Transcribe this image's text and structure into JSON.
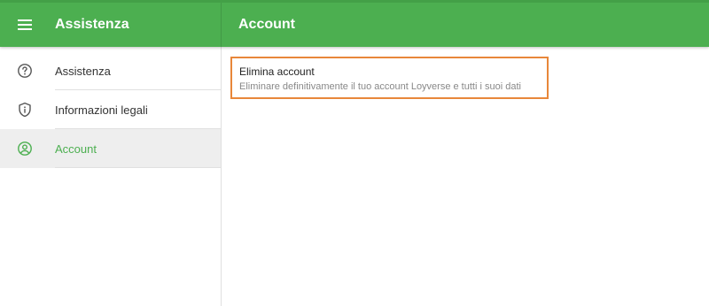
{
  "topbar": {
    "app_title": "Assistenza",
    "section_title": "Account",
    "color": "#4caf50",
    "menu_icon": "hamburger-menu-icon"
  },
  "sidebar": {
    "items": [
      {
        "label": "Assistenza",
        "icon": "help-circle-icon",
        "active": false
      },
      {
        "label": "Informazioni legali",
        "icon": "shield-info-icon",
        "active": false
      },
      {
        "label": "Account",
        "icon": "account-circle-icon",
        "active": true
      }
    ]
  },
  "content": {
    "delete_account": {
      "title": "Elimina account",
      "description": "Eliminare definitivamente il tuo account Loyverse e tutti i suoi dati",
      "highlight_color": "#e8873a"
    }
  }
}
